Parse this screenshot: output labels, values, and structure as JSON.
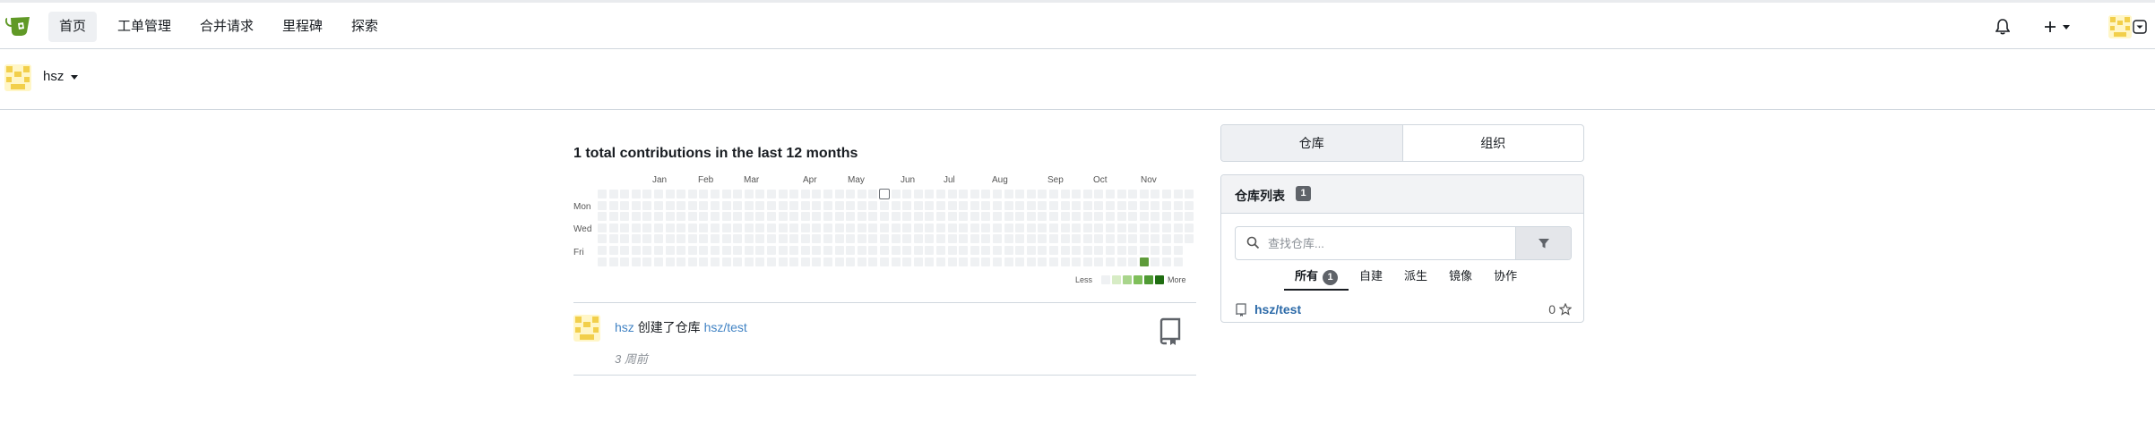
{
  "nav": {
    "items": [
      {
        "label": "首页",
        "active": true
      },
      {
        "label": "工单管理",
        "active": false
      },
      {
        "label": "合并请求",
        "active": false
      },
      {
        "label": "里程碑",
        "active": false
      },
      {
        "label": "探索",
        "active": false
      }
    ],
    "right_icons": [
      "bell-icon",
      "plus-icon",
      "user-avatar"
    ]
  },
  "context": {
    "user": "hsz"
  },
  "heatmap": {
    "title": "1 total contributions in the last 12 months",
    "months": [
      "Jan",
      "Feb",
      "Mar",
      "Apr",
      "May",
      "Jun",
      "Jul",
      "Aug",
      "Sep",
      "Oct",
      "Nov"
    ],
    "days": [
      "Mon",
      "Wed",
      "Fri"
    ],
    "legend_less": "Less",
    "legend_more": "More",
    "colors": [
      "#eff1f3",
      "#d7ecc5",
      "#a9d58c",
      "#7fbf5a",
      "#4f9a34",
      "#1f6d11"
    ],
    "highlight_color": "#5e9b3a",
    "today_outline": "#6b6f75"
  },
  "feed": [
    {
      "user": "hsz",
      "action": "创建了仓库",
      "repo": "hsz/test",
      "time": "3 周前"
    }
  ],
  "switcher": {
    "repos": "仓库",
    "orgs": "组织"
  },
  "repo_panel": {
    "title": "仓库列表",
    "count": "1",
    "search_placeholder": "查找仓库...",
    "tabs": [
      {
        "label": "所有",
        "count": "1",
        "active": true
      },
      {
        "label": "自建",
        "active": false
      },
      {
        "label": "派生",
        "active": false
      },
      {
        "label": "镜像",
        "active": false
      },
      {
        "label": "协作",
        "active": false
      }
    ],
    "repos": [
      {
        "name": "hsz/test",
        "stars": "0"
      }
    ]
  },
  "colors": {
    "link": "#4183c4",
    "accent": "#609926"
  }
}
